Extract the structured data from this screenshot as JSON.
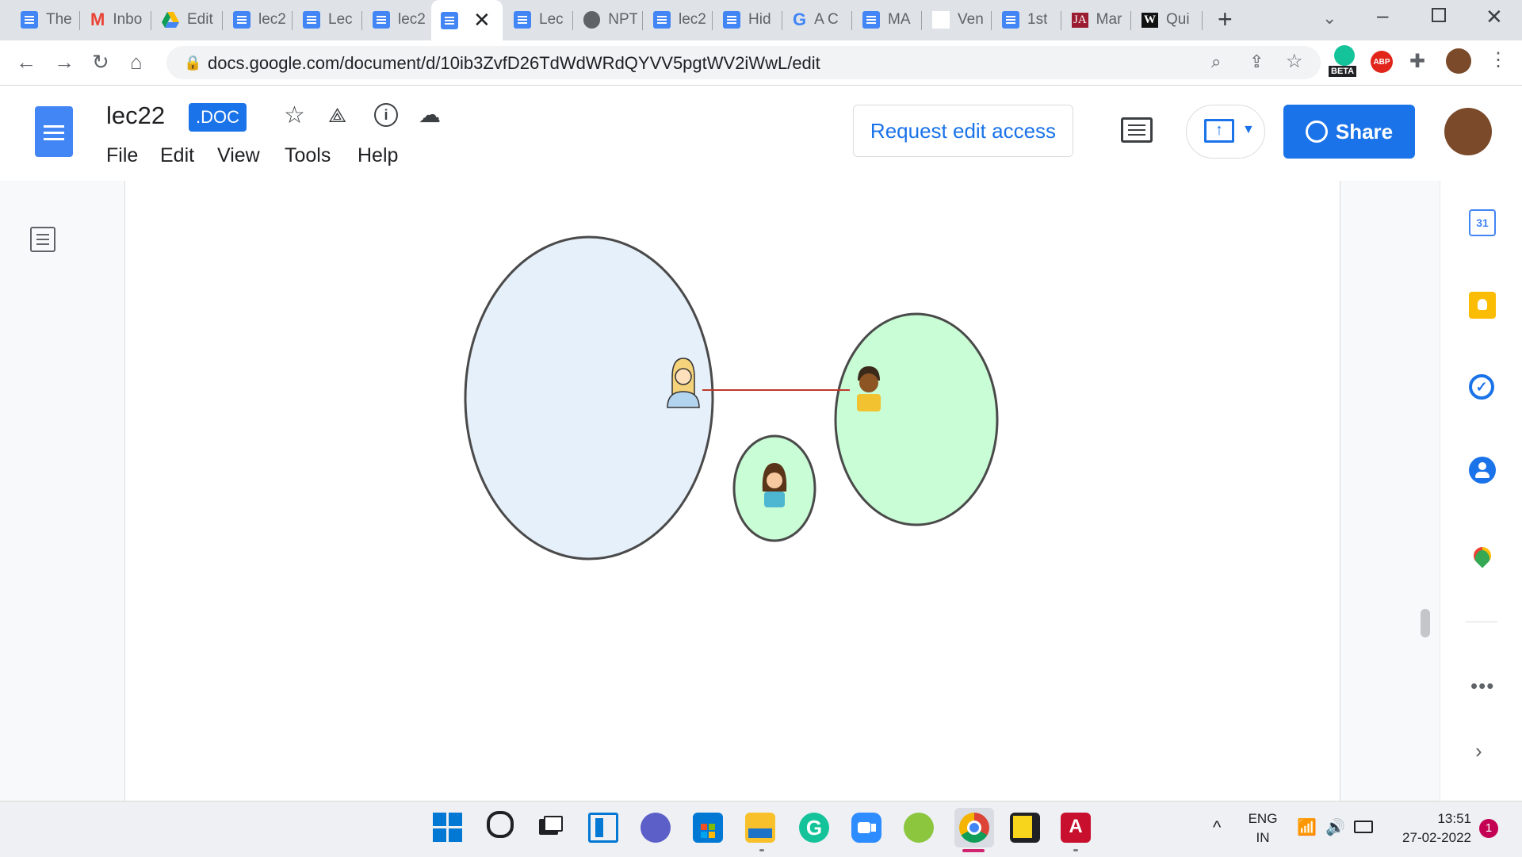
{
  "browser": {
    "tabs": [
      {
        "label": "The",
        "icon": "docs-icon"
      },
      {
        "label": "Inbo",
        "icon": "gmail-icon"
      },
      {
        "label": "Edit",
        "icon": "drive-icon"
      },
      {
        "label": "lec2",
        "icon": "docs-icon"
      },
      {
        "label": "Lec",
        "icon": "docs-icon"
      },
      {
        "label": "lec2",
        "icon": "docs-icon"
      },
      {
        "label": "",
        "icon": "docs-icon",
        "active": true
      },
      {
        "label": "Lec",
        "icon": "docs-icon"
      },
      {
        "label": "NPT",
        "icon": "globe-icon"
      },
      {
        "label": "lec2",
        "icon": "docs-icon"
      },
      {
        "label": "Hid",
        "icon": "docs-icon"
      },
      {
        "label": "A C",
        "icon": "google-icon"
      },
      {
        "label": "MA",
        "icon": "docs-icon"
      },
      {
        "label": "Ven",
        "icon": "blank-icon"
      },
      {
        "label": "1st",
        "icon": "docs-icon"
      },
      {
        "label": "Mar",
        "icon": "ja-icon"
      },
      {
        "label": "Qui",
        "icon": "w-icon"
      }
    ],
    "url": "docs.google.com/document/d/10ib3ZvfD26TdWdWRdQYVV5pgtWV2iWwL/edit",
    "beta_badge": "BETA",
    "abp_badge": "ABP"
  },
  "docs": {
    "title": "lec22",
    "format_badge": ".DOC",
    "menu": [
      "File",
      "Edit",
      "View",
      "Tools",
      "Help"
    ],
    "request_edit": "Request edit access",
    "share": "Share"
  },
  "side_panel": {
    "calendar_day": "31"
  },
  "taskbar": {
    "language": "ENG",
    "region": "IN",
    "time": "13:51",
    "date": "27-02-2022",
    "notification_count": "1"
  },
  "colors": {
    "accent": "#1a73e8",
    "circle_blue": "#e6f0fa",
    "circle_green": "#c8fdd5",
    "connector": "#c0392b"
  }
}
